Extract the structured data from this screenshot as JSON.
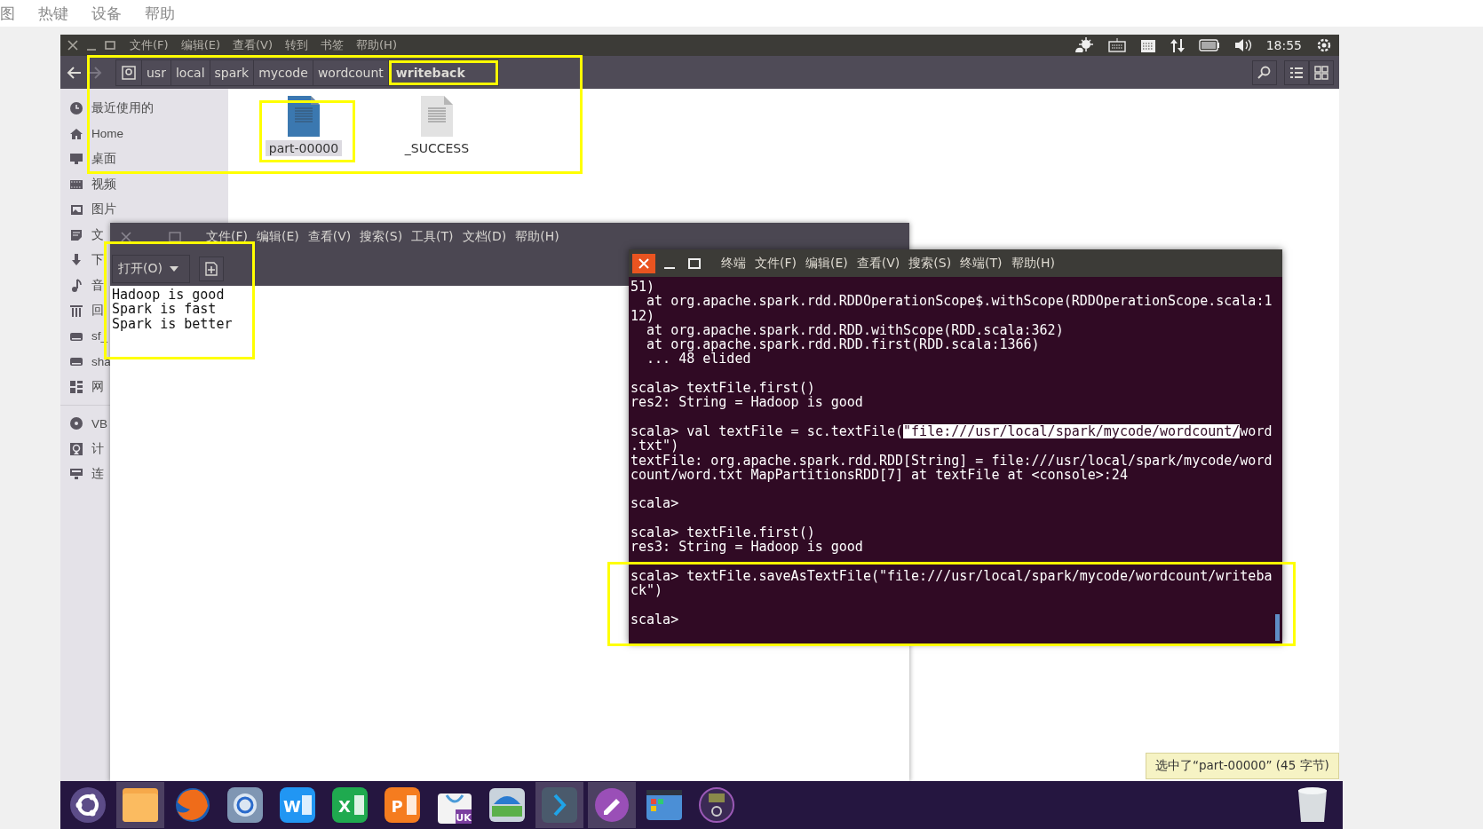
{
  "host_menu": [
    "图",
    "热键",
    "设备",
    "帮助"
  ],
  "panel": {
    "menu": [
      "文件(F)",
      "编辑(E)",
      "查看(V)",
      "转到",
      "书签",
      "帮助(H)"
    ],
    "clock": "18:55"
  },
  "file_manager": {
    "path": [
      {
        "label": "usr",
        "selected": false
      },
      {
        "label": "local",
        "selected": false
      },
      {
        "label": "spark",
        "selected": false
      },
      {
        "label": "mycode",
        "selected": false
      },
      {
        "label": "wordcount",
        "selected": false
      },
      {
        "label": "writeback",
        "selected": true
      }
    ],
    "sidebar": {
      "items": [
        {
          "label": "最近使用的"
        },
        {
          "label": "Home"
        },
        {
          "label": "桌面"
        },
        {
          "label": "视频"
        },
        {
          "label": "图片"
        },
        {
          "label": "文"
        },
        {
          "label": "下"
        },
        {
          "label": "音"
        },
        {
          "label": "回"
        },
        {
          "label": "sf_"
        },
        {
          "label": "sha"
        },
        {
          "label": "网"
        },
        {
          "label": "VB"
        },
        {
          "label": "计"
        },
        {
          "label": "连"
        }
      ]
    },
    "files": [
      {
        "name": "part-00000",
        "selected": true,
        "color": "#3b78b0"
      },
      {
        "name": "_SUCCESS",
        "selected": false,
        "color": "#e2e2e2"
      }
    ]
  },
  "text_editor": {
    "menu": [
      "文件(F)",
      "编辑(E)",
      "查看(V)",
      "搜索(S)",
      "工具(T)",
      "文档(D)",
      "帮助(H)"
    ],
    "open_button": "打开(O)",
    "lines": [
      "Hadoop is good",
      "Spark is fast",
      "Spark is better"
    ]
  },
  "terminal": {
    "menu": [
      "终端",
      "文件(F)",
      "编辑(E)",
      "查看(V)",
      "搜索(S)",
      "终端(T)",
      "帮助(H)"
    ],
    "blocks": [
      [
        "51)",
        "  at org.apache.spark.rdd.RDDOperationScope$.withScope(RDDOperationScope.scala:1",
        "12)",
        "  at org.apache.spark.rdd.RDD.withScope(RDD.scala:362)",
        "  at org.apache.spark.rdd.RDD.first(RDD.scala:1366)",
        "  ... 48 elided"
      ],
      [
        "scala> textFile.first()",
        "res2: String = Hadoop is good"
      ],
      [
        {
          "segments": [
            {
              "text": "scala> val textFile = sc.textFile(",
              "selected": false
            },
            {
              "text": "\"file:///usr/local/spark/mycode/wordcount/",
              "selected": true
            },
            {
              "text": "word",
              "selected": false
            }
          ]
        },
        ".txt\")",
        "textFile: org.apache.spark.rdd.RDD[String] = file:///usr/local/spark/mycode/word",
        "count/word.txt MapPartitionsRDD[7] at textFile at <console>:24"
      ],
      [
        "scala>"
      ],
      [
        "scala> textFile.first()",
        "res3: String = Hadoop is good"
      ],
      [
        "scala> textFile.saveAsTextFile(\"file:///usr/local/spark/mycode/wordcount/writeba",
        "ck\")"
      ],
      [
        "scala>"
      ]
    ]
  },
  "status_tooltip": "选中了“part-00000” (45 字节)",
  "dock": [
    {
      "kind": "launcher",
      "active": false
    },
    {
      "kind": "folder",
      "active": true
    },
    {
      "kind": "browser",
      "active": false
    },
    {
      "kind": "globe",
      "active": false
    },
    {
      "kind": "office",
      "glyph": "W",
      "color": "#2196f3",
      "active": false
    },
    {
      "kind": "office",
      "glyph": "X",
      "color": "#1faa4f",
      "active": false
    },
    {
      "kind": "office",
      "glyph": "P",
      "color": "#f57c1f",
      "active": false
    },
    {
      "kind": "store",
      "glyph": "UK",
      "active": false
    },
    {
      "kind": "scanner",
      "active": false
    },
    {
      "kind": "terminal",
      "active": true
    },
    {
      "kind": "editor",
      "active": true
    },
    {
      "kind": "windows",
      "active": false
    },
    {
      "kind": "disc",
      "active": false
    }
  ]
}
